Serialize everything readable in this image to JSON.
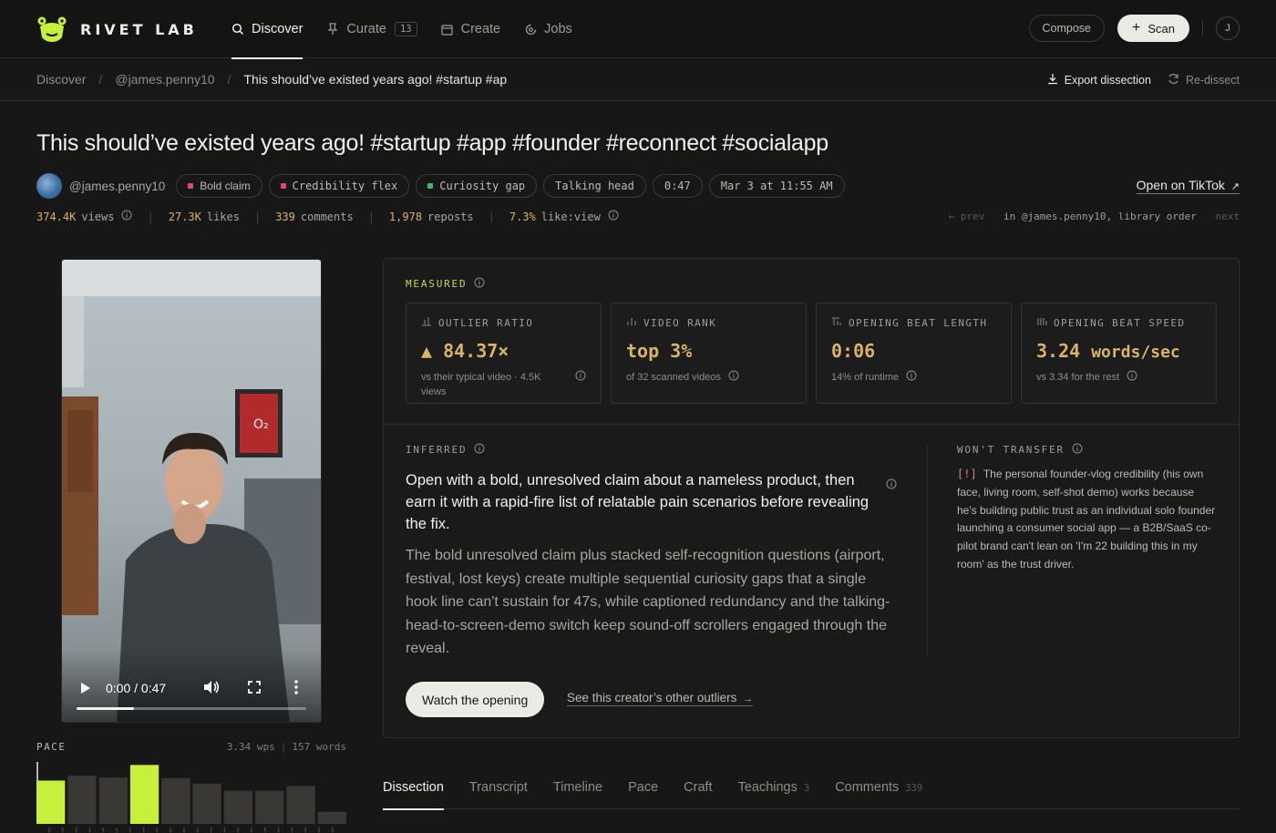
{
  "app": {
    "name": "RIVET LAB"
  },
  "nav": {
    "tabs": [
      {
        "label": "Discover",
        "icon": "search-icon",
        "active": true
      },
      {
        "label": "Curate",
        "icon": "pin-icon",
        "badge": "13"
      },
      {
        "label": "Create",
        "icon": "calendar-icon"
      },
      {
        "label": "Jobs",
        "icon": "spinner-icon"
      }
    ],
    "compose_label": "Compose",
    "scan_label": "Scan",
    "user_initial": "J"
  },
  "breadcrumb": {
    "items": [
      "Discover",
      "@james.penny10",
      "This should’ve existed years ago! #startup #ap"
    ],
    "export_label": "Export dissection",
    "redissect_label": "Re-dissect"
  },
  "post": {
    "title": "This should’ve existed years ago! #startup #app #founder #reconnect #socialapp",
    "handle": "@james.penny10",
    "tags": [
      {
        "label": "Bold claim",
        "color": "#d9487a"
      },
      {
        "label": "Credibility flex",
        "color": "#d9487a"
      },
      {
        "label": "Curiosity gap",
        "color": "#3fb56a"
      },
      {
        "label": "Talking head"
      },
      {
        "label": "0:47"
      },
      {
        "label": "Mar 3 at 11:55 AM"
      }
    ],
    "open_label": "Open on TikTok",
    "stats": [
      {
        "num": "374.4K",
        "label": "views",
        "info": true
      },
      {
        "num": "27.3K",
        "label": "likes"
      },
      {
        "num": "339",
        "label": "comments"
      },
      {
        "num": "1,978",
        "label": "reposts"
      },
      {
        "num": "7.3%",
        "label": "like:view",
        "info": true
      }
    ],
    "prev_label": "← prev",
    "order_label": "in @james.penny10, library order",
    "next_label": "next"
  },
  "video": {
    "time": "0:00 / 0:47",
    "progress": 0.25
  },
  "pace": {
    "label": "PACE",
    "wps": "3.34 wps",
    "words": "157 words",
    "bars": [
      0.72,
      0.8,
      0.77,
      0.98,
      0.76,
      0.67,
      0.55,
      0.55,
      0.63,
      0.2
    ],
    "highlight": [
      0,
      3
    ],
    "colors": {
      "highlight": "#c6f03c",
      "normal": "#3a3835"
    }
  },
  "measured": {
    "label": "MEASURED",
    "cards": [
      {
        "icon": "ratio-icon",
        "title": "OUTLIER RATIO",
        "value": "▲ 84.37×",
        "unit": "",
        "sub": "vs their typical video · 4.5K views"
      },
      {
        "icon": "rank-icon",
        "title": "VIDEO RANK",
        "value": "top 3%",
        "unit": "",
        "sub": "of 32 scanned videos"
      },
      {
        "icon": "beat-length-icon",
        "title": "OPENING BEAT LENGTH",
        "value": "0:06",
        "unit": "",
        "sub": "14% of runtime"
      },
      {
        "icon": "beat-speed-icon",
        "title": "OPENING BEAT SPEED",
        "value": "3.24",
        "unit": "words/sec",
        "sub": "vs 3.34 for the rest"
      }
    ]
  },
  "inferred": {
    "label": "INFERRED",
    "headline": "Open with a bold, unresolved claim about a nameless product, then earn it with a rapid-fire list of relatable pain scenarios before revealing the fix.",
    "body": "The bold unresolved claim plus stacked self-recognition questions (airport, festival, lost keys) create multiple sequential curiosity gaps that a single hook line can't sustain for 47s, while captioned redundancy and the talking-head-to-screen-demo switch keep sound-off scrollers engaged through the reveal.",
    "watch_label": "Watch the opening",
    "outliers_label": "See this creator’s other outliers"
  },
  "wont_transfer": {
    "label": "WON'T TRANSFER",
    "marker": "[!]",
    "body": "The personal founder-vlog credibility (his own face, living room, self-shot demo) works because he's building public trust as an individual solo founder launching a consumer social app — a B2B/SaaS co-pilot brand can't lean on 'I'm 22 building this in my room' as the trust driver."
  },
  "bottom_tabs": [
    {
      "label": "Dissection",
      "active": true
    },
    {
      "label": "Transcript"
    },
    {
      "label": "Timeline"
    },
    {
      "label": "Pace"
    },
    {
      "label": "Craft"
    },
    {
      "label": "Teachings",
      "count": "3"
    },
    {
      "label": "Comments",
      "count": "339"
    }
  ]
}
